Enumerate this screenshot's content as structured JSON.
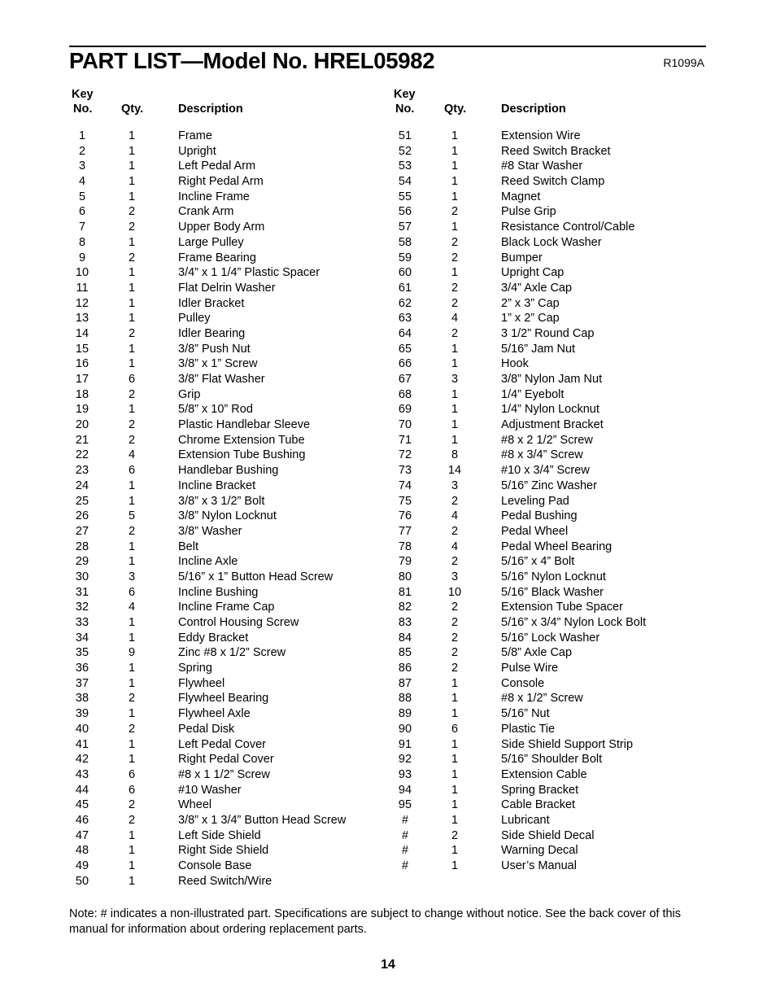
{
  "header": {
    "title": "PART LIST—Model No. HREL05982",
    "doc_code": "R1099A"
  },
  "columns_header": {
    "key_line1": "Key",
    "key_line2": "No.",
    "qty": "Qty.",
    "description": "Description"
  },
  "parts_left": [
    {
      "key": "1",
      "qty": "1",
      "desc": "Frame"
    },
    {
      "key": "2",
      "qty": "1",
      "desc": "Upright"
    },
    {
      "key": "3",
      "qty": "1",
      "desc": "Left Pedal Arm"
    },
    {
      "key": "4",
      "qty": "1",
      "desc": "Right Pedal Arm"
    },
    {
      "key": "5",
      "qty": "1",
      "desc": "Incline Frame"
    },
    {
      "key": "6",
      "qty": "2",
      "desc": "Crank Arm"
    },
    {
      "key": "7",
      "qty": "2",
      "desc": "Upper Body Arm"
    },
    {
      "key": "8",
      "qty": "1",
      "desc": "Large Pulley"
    },
    {
      "key": "9",
      "qty": "2",
      "desc": "Frame Bearing"
    },
    {
      "key": "10",
      "qty": "1",
      "desc": "3/4” x 1 1/4” Plastic Spacer"
    },
    {
      "key": "11",
      "qty": "1",
      "desc": "Flat Delrin Washer"
    },
    {
      "key": "12",
      "qty": "1",
      "desc": "Idler Bracket"
    },
    {
      "key": "13",
      "qty": "1",
      "desc": "Pulley"
    },
    {
      "key": "14",
      "qty": "2",
      "desc": "Idler Bearing"
    },
    {
      "key": "15",
      "qty": "1",
      "desc": "3/8” Push Nut"
    },
    {
      "key": "16",
      "qty": "1",
      "desc": "3/8” x 1” Screw"
    },
    {
      "key": "17",
      "qty": "6",
      "desc": "3/8” Flat Washer"
    },
    {
      "key": "18",
      "qty": "2",
      "desc": "Grip"
    },
    {
      "key": "19",
      "qty": "1",
      "desc": "5/8” x 10” Rod"
    },
    {
      "key": "20",
      "qty": "2",
      "desc": "Plastic Handlebar Sleeve"
    },
    {
      "key": "21",
      "qty": "2",
      "desc": "Chrome Extension Tube"
    },
    {
      "key": "22",
      "qty": "4",
      "desc": "Extension Tube Bushing"
    },
    {
      "key": "23",
      "qty": "6",
      "desc": "Handlebar Bushing"
    },
    {
      "key": "24",
      "qty": "1",
      "desc": "Incline Bracket"
    },
    {
      "key": "25",
      "qty": "1",
      "desc": "3/8” x 3 1/2” Bolt"
    },
    {
      "key": "26",
      "qty": "5",
      "desc": "3/8” Nylon Locknut"
    },
    {
      "key": "27",
      "qty": "2",
      "desc": "3/8” Washer"
    },
    {
      "key": "28",
      "qty": "1",
      "desc": "Belt"
    },
    {
      "key": "29",
      "qty": "1",
      "desc": "Incline Axle"
    },
    {
      "key": "30",
      "qty": "3",
      "desc": "5/16” x 1” Button Head Screw"
    },
    {
      "key": "31",
      "qty": "6",
      "desc": "Incline Bushing"
    },
    {
      "key": "32",
      "qty": "4",
      "desc": "Incline Frame Cap"
    },
    {
      "key": "33",
      "qty": "1",
      "desc": "Control Housing Screw"
    },
    {
      "key": "34",
      "qty": "1",
      "desc": "Eddy Bracket"
    },
    {
      "key": "35",
      "qty": "9",
      "desc": "Zinc #8 x 1/2” Screw"
    },
    {
      "key": "36",
      "qty": "1",
      "desc": "Spring"
    },
    {
      "key": "37",
      "qty": "1",
      "desc": "Flywheel"
    },
    {
      "key": "38",
      "qty": "2",
      "desc": "Flywheel Bearing"
    },
    {
      "key": "39",
      "qty": "1",
      "desc": "Flywheel Axle"
    },
    {
      "key": "40",
      "qty": "2",
      "desc": "Pedal Disk"
    },
    {
      "key": "41",
      "qty": "1",
      "desc": "Left Pedal Cover"
    },
    {
      "key": "42",
      "qty": "1",
      "desc": "Right Pedal Cover"
    },
    {
      "key": "43",
      "qty": "6",
      "desc": "#8 x 1 1/2” Screw"
    },
    {
      "key": "44",
      "qty": "6",
      "desc": "#10 Washer"
    },
    {
      "key": "45",
      "qty": "2",
      "desc": "Wheel"
    },
    {
      "key": "46",
      "qty": "2",
      "desc": "3/8” x 1 3/4” Button Head Screw"
    },
    {
      "key": "47",
      "qty": "1",
      "desc": "Left Side Shield"
    },
    {
      "key": "48",
      "qty": "1",
      "desc": "Right Side Shield"
    },
    {
      "key": "49",
      "qty": "1",
      "desc": "Console Base"
    },
    {
      "key": "50",
      "qty": "1",
      "desc": "Reed Switch/Wire"
    }
  ],
  "parts_right": [
    {
      "key": "51",
      "qty": "1",
      "desc": "Extension Wire"
    },
    {
      "key": "52",
      "qty": "1",
      "desc": "Reed Switch Bracket"
    },
    {
      "key": "53",
      "qty": "1",
      "desc": "#8 Star Washer"
    },
    {
      "key": "54",
      "qty": "1",
      "desc": "Reed Switch Clamp"
    },
    {
      "key": "55",
      "qty": "1",
      "desc": "Magnet"
    },
    {
      "key": "56",
      "qty": "2",
      "desc": "Pulse Grip"
    },
    {
      "key": "57",
      "qty": "1",
      "desc": "Resistance Control/Cable"
    },
    {
      "key": "58",
      "qty": "2",
      "desc": "Black Lock Washer"
    },
    {
      "key": "59",
      "qty": "2",
      "desc": "Bumper"
    },
    {
      "key": "60",
      "qty": "1",
      "desc": "Upright Cap"
    },
    {
      "key": "61",
      "qty": "2",
      "desc": "3/4” Axle Cap"
    },
    {
      "key": "62",
      "qty": "2",
      "desc": "2” x 3” Cap"
    },
    {
      "key": "63",
      "qty": "4",
      "desc": "1” x 2” Cap"
    },
    {
      "key": "64",
      "qty": "2",
      "desc": "3 1/2” Round Cap"
    },
    {
      "key": "65",
      "qty": "1",
      "desc": "5/16” Jam Nut"
    },
    {
      "key": "66",
      "qty": "1",
      "desc": "Hook"
    },
    {
      "key": "67",
      "qty": "3",
      "desc": "3/8” Nylon Jam Nut"
    },
    {
      "key": "68",
      "qty": "1",
      "desc": "1/4” Eyebolt"
    },
    {
      "key": "69",
      "qty": "1",
      "desc": "1/4” Nylon Locknut"
    },
    {
      "key": "70",
      "qty": "1",
      "desc": "Adjustment Bracket"
    },
    {
      "key": "71",
      "qty": "1",
      "desc": "#8 x 2 1/2” Screw"
    },
    {
      "key": "72",
      "qty": "8",
      "desc": "#8 x 3/4” Screw"
    },
    {
      "key": "73",
      "qty": "14",
      "desc": "#10 x 3/4” Screw"
    },
    {
      "key": "74",
      "qty": "3",
      "desc": "5/16” Zinc Washer"
    },
    {
      "key": "75",
      "qty": "2",
      "desc": "Leveling Pad"
    },
    {
      "key": "76",
      "qty": "4",
      "desc": "Pedal Bushing"
    },
    {
      "key": "77",
      "qty": "2",
      "desc": "Pedal Wheel"
    },
    {
      "key": "78",
      "qty": "4",
      "desc": "Pedal Wheel Bearing"
    },
    {
      "key": "79",
      "qty": "2",
      "desc": "5/16” x 4” Bolt"
    },
    {
      "key": "80",
      "qty": "3",
      "desc": "5/16” Nylon Locknut"
    },
    {
      "key": "81",
      "qty": "10",
      "desc": "5/16” Black Washer"
    },
    {
      "key": "82",
      "qty": "2",
      "desc": "Extension Tube Spacer"
    },
    {
      "key": "83",
      "qty": "2",
      "desc": "5/16” x 3/4” Nylon Lock Bolt"
    },
    {
      "key": "84",
      "qty": "2",
      "desc": "5/16” Lock Washer"
    },
    {
      "key": "85",
      "qty": "2",
      "desc": "5/8” Axle Cap"
    },
    {
      "key": "86",
      "qty": "2",
      "desc": "Pulse Wire"
    },
    {
      "key": "87",
      "qty": "1",
      "desc": "Console"
    },
    {
      "key": "88",
      "qty": "1",
      "desc": "#8 x 1/2” Screw"
    },
    {
      "key": "89",
      "qty": "1",
      "desc": "5/16” Nut"
    },
    {
      "key": "90",
      "qty": "6",
      "desc": "Plastic Tie"
    },
    {
      "key": "91",
      "qty": "1",
      "desc": "Side Shield Support Strip"
    },
    {
      "key": "92",
      "qty": "1",
      "desc": "5/16” Shoulder Bolt"
    },
    {
      "key": "93",
      "qty": "1",
      "desc": "Extension Cable"
    },
    {
      "key": "94",
      "qty": "1",
      "desc": "Spring Bracket"
    },
    {
      "key": "95",
      "qty": "1",
      "desc": "Cable Bracket"
    },
    {
      "key": "#",
      "qty": "1",
      "desc": "Lubricant"
    },
    {
      "key": "#",
      "qty": "2",
      "desc": "Side Shield Decal"
    },
    {
      "key": "#",
      "qty": "1",
      "desc": "Warning Decal"
    },
    {
      "key": "#",
      "qty": "1",
      "desc": "User’s Manual"
    }
  ],
  "footer": {
    "note": "Note: # indicates a non-illustrated part. Specifications are subject to change without notice. See the back cover of this manual for information about ordering replacement parts.",
    "page_number": "14"
  }
}
